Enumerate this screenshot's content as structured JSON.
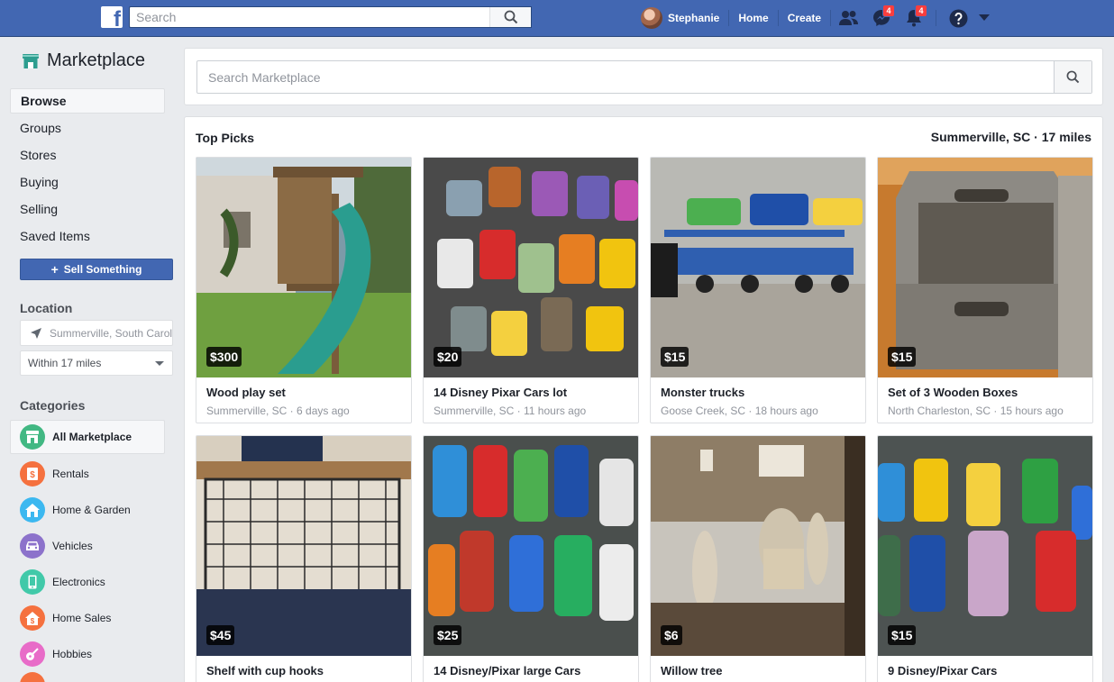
{
  "topbar": {
    "search_placeholder": "Search",
    "user_name": "Stephanie",
    "home_label": "Home",
    "create_label": "Create",
    "messages_badge": "4",
    "notifications_badge": "4"
  },
  "sidebar": {
    "title": "Marketplace",
    "nav": [
      "Browse",
      "Groups",
      "Stores",
      "Buying",
      "Selling",
      "Saved Items"
    ],
    "sell_button": "Sell Something",
    "location_label": "Location",
    "location_value": "Summerville, South Carolina",
    "radius_value": "Within 17 miles",
    "categories_label": "Categories",
    "categories": [
      {
        "label": "All Marketplace",
        "color": "#42b883",
        "icon": "store-icon"
      },
      {
        "label": "Rentals",
        "color": "#f5713f",
        "icon": "rentals-icon"
      },
      {
        "label": "Home & Garden",
        "color": "#3cb8f0",
        "icon": "house-icon"
      },
      {
        "label": "Vehicles",
        "color": "#8c72cb",
        "icon": "car-icon"
      },
      {
        "label": "Electronics",
        "color": "#41c9a9",
        "icon": "phone-icon"
      },
      {
        "label": "Home Sales",
        "color": "#f5713f",
        "icon": "home-sales-icon"
      },
      {
        "label": "Hobbies",
        "color": "#e86cc8",
        "icon": "guitar-icon"
      }
    ]
  },
  "main": {
    "search_placeholder": "Search Marketplace",
    "section_title": "Top Picks",
    "location_summary": "Summerville, SC · 17 miles",
    "listings": [
      {
        "price": "$300",
        "title": "Wood play set",
        "meta": "Summerville, SC · 6 days ago"
      },
      {
        "price": "$20",
        "title": "14 Disney Pixar Cars lot",
        "meta": "Summerville, SC · 11 hours ago"
      },
      {
        "price": "$15",
        "title": "Monster trucks",
        "meta": "Goose Creek, SC · 18 hours ago"
      },
      {
        "price": "$15",
        "title": "Set of 3 Wooden Boxes",
        "meta": "North Charleston, SC · 15 hours ago"
      },
      {
        "price": "$45",
        "title": "Shelf with cup hooks",
        "meta": ""
      },
      {
        "price": "$25",
        "title": "14 Disney/Pixar large Cars",
        "meta": ""
      },
      {
        "price": "$6",
        "title": "Willow tree",
        "meta": ""
      },
      {
        "price": "$15",
        "title": "9 Disney/Pixar Cars",
        "meta": ""
      }
    ]
  },
  "colors": {
    "brand_blue": "#4267b2",
    "page_bg": "#e9ebee",
    "badge_red": "#fa3e3e"
  }
}
